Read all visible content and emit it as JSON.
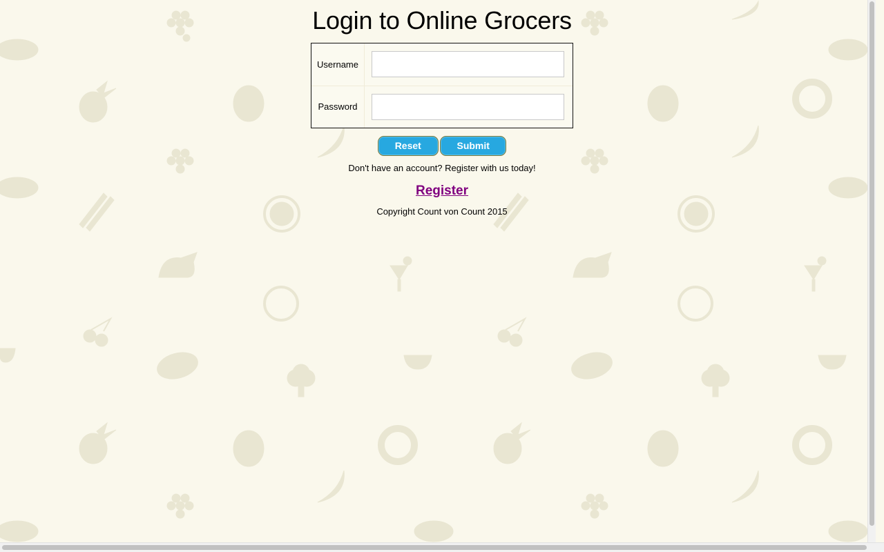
{
  "page": {
    "title": "Login to Online Grocers"
  },
  "form": {
    "username_label": "Username",
    "username_value": "",
    "password_label": "Password",
    "password_value": ""
  },
  "buttons": {
    "reset_label": "Reset",
    "submit_label": "Submit"
  },
  "signup": {
    "prompt": "Don't have an account? Register with us today!",
    "link_label": "Register"
  },
  "footer": {
    "copyright": "Copyright Count von Count 2015"
  },
  "colors": {
    "background": "#faf8ec",
    "button": "#27a8e0",
    "link": "#800080",
    "pattern": "#e9e6d2"
  },
  "background_icons": [
    "grapes-icon",
    "pineapple-icon",
    "watermelon-icon",
    "donut-icon",
    "banana-icon",
    "steak-icon",
    "asparagus-icon",
    "orange-slice-icon",
    "chicken-icon",
    "cocktail-icon",
    "cherries-icon",
    "sausage-icon",
    "broccoli-icon",
    "grill-icon",
    "plate-icon"
  ]
}
